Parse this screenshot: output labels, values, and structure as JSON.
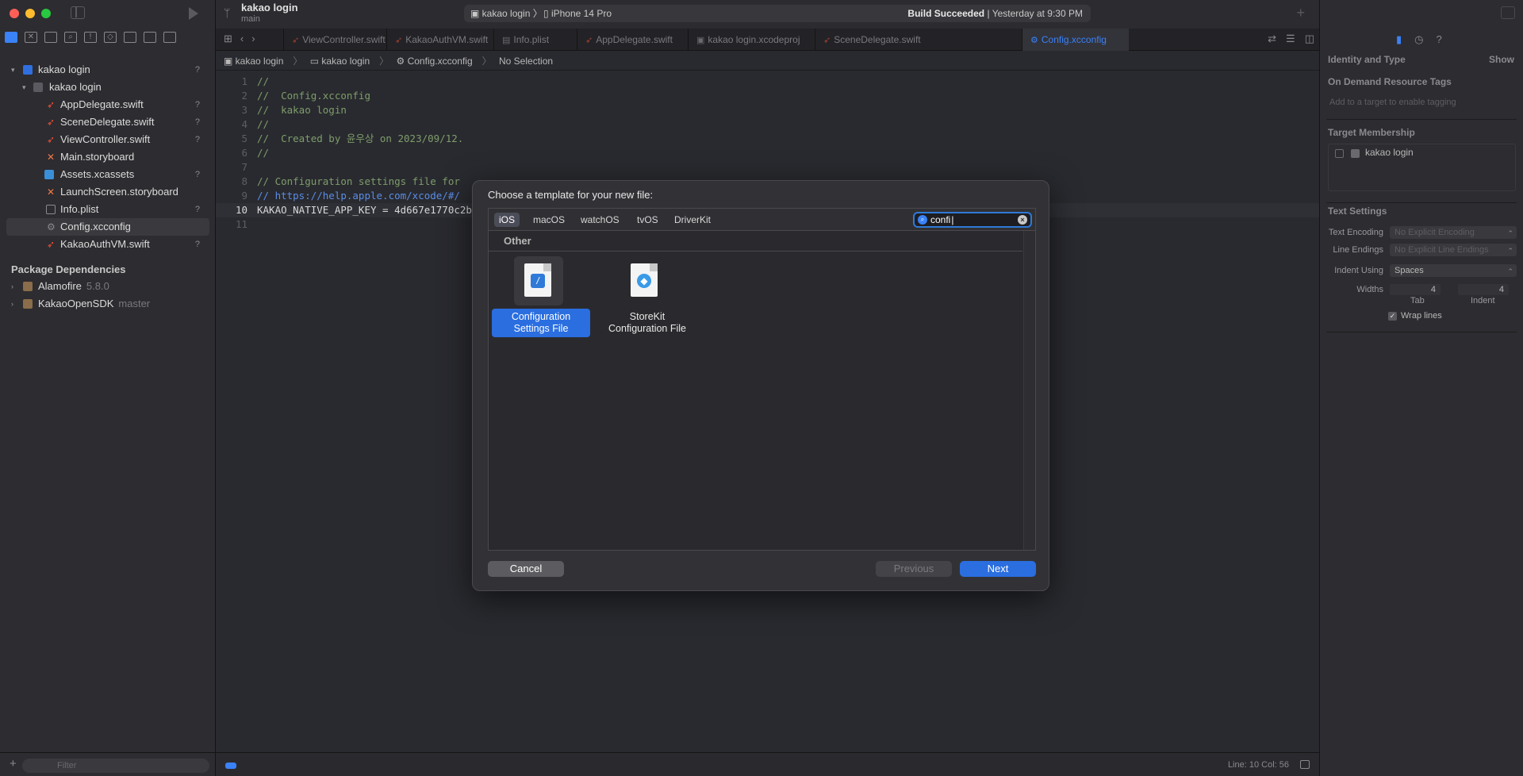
{
  "toolbar": {
    "project": "kakao login",
    "branch": "main",
    "scheme": "kakao login",
    "destination": "iPhone 14 Pro",
    "build_status_bold": "Build Succeeded",
    "build_status_rest": " | Yesterday at 9:30 PM"
  },
  "navigator": {
    "project": "kakao login",
    "group": "kakao login",
    "files": [
      {
        "name": "AppDelegate.swift",
        "badge": "?"
      },
      {
        "name": "SceneDelegate.swift",
        "badge": "?"
      },
      {
        "name": "ViewController.swift",
        "badge": "?"
      },
      {
        "name": "Main.storyboard",
        "badge": ""
      },
      {
        "name": "Assets.xcassets",
        "badge": "?"
      },
      {
        "name": "LaunchScreen.storyboard",
        "badge": ""
      },
      {
        "name": "Info.plist",
        "badge": "?"
      },
      {
        "name": "Config.xcconfig",
        "badge": ""
      },
      {
        "name": "KakaoAuthVM.swift",
        "badge": "?"
      }
    ],
    "project_badge": "?",
    "packages_title": "Package Dependencies",
    "packages": [
      {
        "name": "Alamofire",
        "version": "5.8.0"
      },
      {
        "name": "KakaoOpenSDK",
        "version": "master"
      }
    ],
    "filter_placeholder": "Filter"
  },
  "tabs": [
    {
      "label": "ViewController.swift",
      "active": false
    },
    {
      "label": "KakaoAuthVM.swift",
      "active": false
    },
    {
      "label": "Info.plist",
      "active": false
    },
    {
      "label": "AppDelegate.swift",
      "active": false
    },
    {
      "label": "kakao login.xcodeproj",
      "active": false
    },
    {
      "label": "SceneDelegate.swift",
      "active": false
    },
    {
      "label": "Config.xcconfig",
      "active": true
    }
  ],
  "jumpbar": [
    "kakao login",
    "kakao login",
    "Config.xcconfig",
    "No Selection"
  ],
  "editor": {
    "lines": [
      {
        "n": "1",
        "text": "//",
        "kind": "cmt"
      },
      {
        "n": "2",
        "text": "//  Config.xcconfig",
        "kind": "cmt"
      },
      {
        "n": "3",
        "text": "//  kakao login",
        "kind": "cmt"
      },
      {
        "n": "4",
        "text": "//",
        "kind": "cmt"
      },
      {
        "n": "5",
        "text": "//  Created by 윤우상 on 2023/09/12.",
        "kind": "cmt"
      },
      {
        "n": "6",
        "text": "//",
        "kind": "cmt"
      },
      {
        "n": "7",
        "text": "",
        "kind": "plain"
      },
      {
        "n": "8",
        "text": "// Configuration settings file for",
        "kind": "cmt"
      },
      {
        "n": "9",
        "text": "// https://help.apple.com/xcode/#/",
        "kind": "url"
      },
      {
        "n": "10",
        "text": "KAKAO_NATIVE_APP_KEY = 4d667e1770c2b",
        "kind": "plain"
      },
      {
        "n": "11",
        "text": "",
        "kind": "plain"
      }
    ],
    "current_line": "10"
  },
  "statusbar": {
    "position": "Line: 10  Col: 56"
  },
  "inspector": {
    "identity_title": "Identity and Type",
    "show_label": "Show",
    "odr_title": "On Demand Resource Tags",
    "odr_placeholder": "Add to a target to enable tagging",
    "tm_title": "Target Membership",
    "tm_target": "kakao login",
    "text_settings_title": "Text Settings",
    "text_encoding_label": "Text Encoding",
    "text_encoding_value": "No Explicit Encoding",
    "line_endings_label": "Line Endings",
    "line_endings_value": "No Explicit Line Endings",
    "indent_using_label": "Indent Using",
    "indent_using_value": "Spaces",
    "widths_label": "Widths",
    "tab_width": "4",
    "indent_width": "4",
    "tab_caption": "Tab",
    "indent_caption": "Indent",
    "wrap_label": "Wrap lines"
  },
  "dialog": {
    "title": "Choose a template for your new file:",
    "platforms": [
      {
        "label": "iOS",
        "selected": true
      },
      {
        "label": "macOS",
        "selected": false
      },
      {
        "label": "watchOS",
        "selected": false
      },
      {
        "label": "tvOS",
        "selected": false
      },
      {
        "label": "DriverKit",
        "selected": false
      }
    ],
    "search_value": "confi",
    "group_title": "Other",
    "templates": [
      {
        "line1": "Configuration",
        "line2": "Settings File",
        "selected": true
      },
      {
        "line1": "StoreKit",
        "line2": "Configuration File",
        "selected": false
      }
    ],
    "cancel_label": "Cancel",
    "previous_label": "Previous",
    "next_label": "Next"
  }
}
